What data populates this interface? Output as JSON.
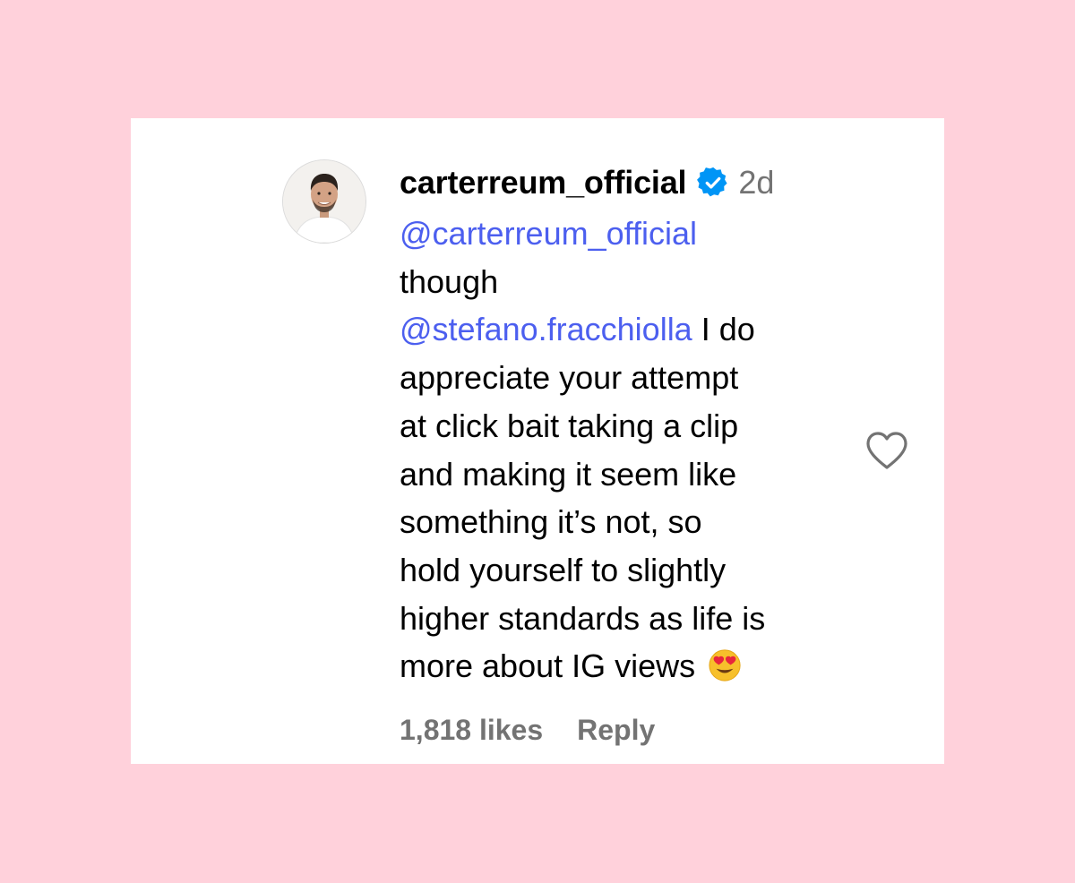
{
  "comment": {
    "username": "carterreum_official",
    "time": "2d",
    "lines": [
      {
        "mention": "@carterreum_official",
        "text": ""
      },
      {
        "mention": "",
        "text": "though"
      },
      {
        "mention": "@stefano.fracchiolla",
        "text": " I do"
      },
      {
        "mention": "",
        "text": "appreciate your attempt"
      },
      {
        "mention": "",
        "text": "at click bait taking a clip"
      },
      {
        "mention": "",
        "text": "and making it seem like"
      },
      {
        "mention": "",
        "text": "something it’s not, so"
      },
      {
        "mention": "",
        "text": "hold yourself to slightly"
      },
      {
        "mention": "",
        "text": "higher standards as life is"
      },
      {
        "mention": "",
        "text": "more about IG views "
      }
    ],
    "likes": "1,818 likes",
    "reply_label": "Reply"
  },
  "icons": {
    "verified": "verified-badge-icon",
    "like": "heart-icon",
    "emoji": "heart-eyes-emoji"
  },
  "colors": {
    "page_background": "#ffd1db",
    "card_background": "#ffffff",
    "mention": "#4c5fef",
    "verified": "#0095f6",
    "secondary_text": "#737373"
  }
}
